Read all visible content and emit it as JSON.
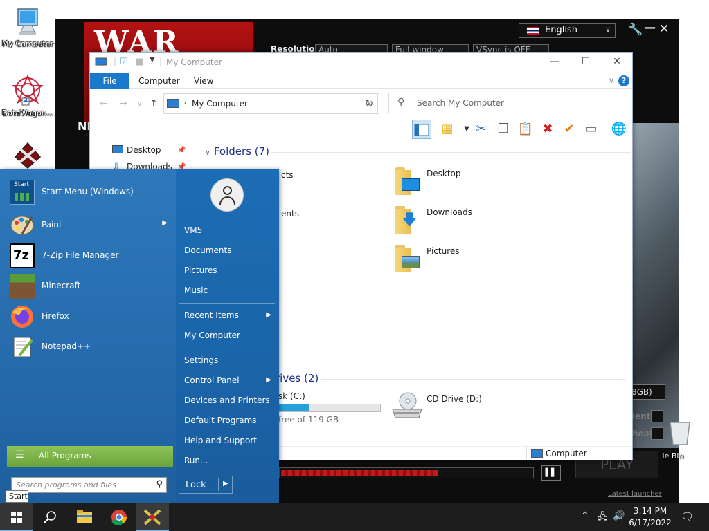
{
  "desktop": {
    "icons": [
      {
        "label": "My Computer"
      },
      {
        "label": "DataWagon..."
      },
      {
        "label": ""
      },
      {
        "label": "Recycle Bin"
      }
    ]
  },
  "launcher": {
    "banner_text": "WAR",
    "language": "English",
    "resolution_label": "Resolution",
    "resolution_value": "Auto",
    "window_mode": "Full window",
    "vsync": "VSync is OFF",
    "news_label": "NE",
    "memory": "8GB)",
    "option1": "ient",
    "option2": "heat",
    "play": "PLAY",
    "pause_glyph": "▌▌",
    "progress_fraction": 0.62,
    "latest_launcher": "Latest launcher"
  },
  "explorer": {
    "title": "My Computer",
    "tabs": {
      "file": "File",
      "computer": "Computer",
      "view": "View"
    },
    "help": "?",
    "address": "My Computer",
    "search_placeholder": "Search My Computer",
    "sidebar": [
      {
        "label": "Desktop"
      },
      {
        "label": "Downloads"
      }
    ],
    "folders_header": "Folders (7)",
    "folders_partial": [
      {
        "label": "cts"
      },
      {
        "label": "ents"
      }
    ],
    "folders": [
      {
        "label": "Desktop"
      },
      {
        "label": "Downloads"
      },
      {
        "label": "Pictures"
      }
    ],
    "drives_header": "rives (2)",
    "local_disk": {
      "label": "sk (C:)",
      "free": "free of 119 GB",
      "used_fraction": 0.3
    },
    "cd_drive": {
      "label": "CD Drive (D:)"
    },
    "status_text": "Computer",
    "colors": {
      "accent": "#1979ca",
      "header_text": "#1e3287"
    }
  },
  "start_menu": {
    "pinned": [
      {
        "label": "Start Menu (Windows)",
        "icon": "start-menu-app-icon"
      },
      {
        "label": "Paint",
        "icon": "paint-icon",
        "submenu": true
      },
      {
        "label": "7-Zip File Manager",
        "icon": "7zip-icon",
        "icon_text": "7z"
      },
      {
        "label": "Minecraft",
        "icon": "minecraft-icon"
      },
      {
        "label": "Firefox",
        "icon": "firefox-icon"
      },
      {
        "label": "Notepad++",
        "icon": "notepad-plus-plus-icon"
      }
    ],
    "start_tile_text": "Start",
    "all_programs": "All Programs",
    "search_placeholder": "Search programs and files",
    "right": {
      "user": "VM5",
      "documents": "Documents",
      "pictures": "Pictures",
      "music": "Music",
      "recent_items": "Recent Items",
      "my_computer": "My Computer",
      "settings": "Settings",
      "control_panel": "Control Panel",
      "devices_printers": "Devices and Printers",
      "default_programs": "Default Programs",
      "help_support": "Help and Support",
      "run": "Run..."
    },
    "lock": "Lock",
    "tooltip": "Start"
  },
  "taskbar": {
    "time": "3:14 PM",
    "date": "6/17/2022"
  }
}
